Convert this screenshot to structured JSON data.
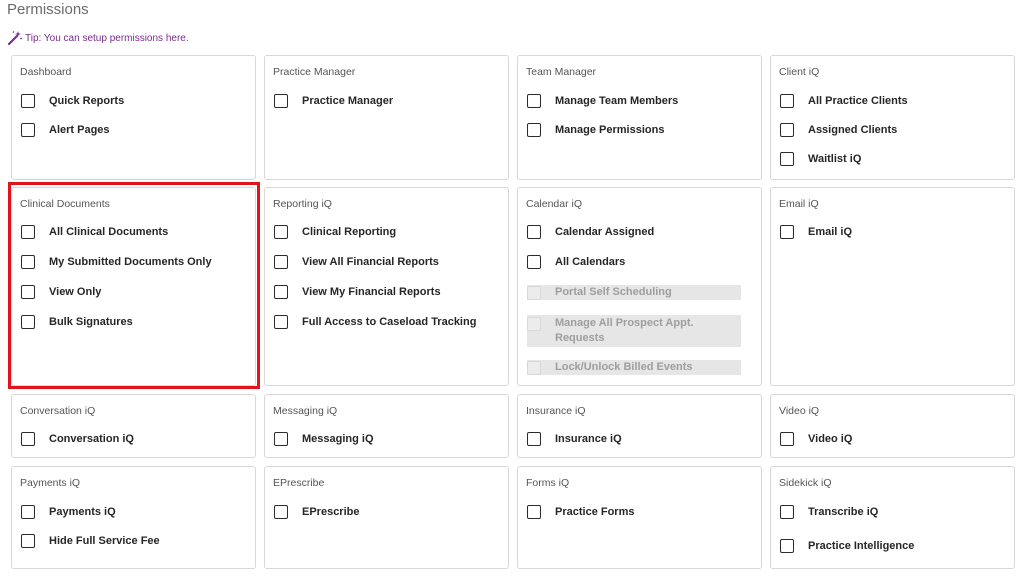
{
  "page": {
    "title": "Permissions",
    "tip": "Tip: You can setup permissions here."
  },
  "colors": {
    "highlight": "#e0141b",
    "tip": "#7a2b8c"
  },
  "cards": {
    "dashboard": {
      "title": "Dashboard",
      "items": [
        "Quick Reports",
        "Alert Pages"
      ]
    },
    "practice_manager": {
      "title": "Practice Manager",
      "items": [
        "Practice Manager"
      ]
    },
    "team_manager": {
      "title": "Team Manager",
      "items": [
        "Manage Team Members",
        "Manage Permissions"
      ]
    },
    "client_iq": {
      "title": "Client iQ",
      "items": [
        "All Practice Clients",
        "Assigned Clients",
        "Waitlist iQ"
      ]
    },
    "clinical_documents": {
      "title": "Clinical Documents",
      "items": [
        "All Clinical Documents",
        "My Submitted Documents Only",
        "View Only",
        "Bulk Signatures"
      ]
    },
    "reporting_iq": {
      "title": "Reporting iQ",
      "items": [
        "Clinical Reporting",
        "View All Financial Reports",
        "View My Financial Reports",
        "Full Access to Caseload Tracking"
      ]
    },
    "calendar_iq": {
      "title": "Calendar iQ",
      "items": [
        "Calendar Assigned",
        "All Calendars"
      ],
      "disabled_items": [
        "Portal Self Scheduling",
        "Manage All Prospect Appt. Requests",
        "Lock/Unlock Billed Events"
      ]
    },
    "email_iq": {
      "title": "Email iQ",
      "items": [
        "Email iQ"
      ]
    },
    "conversation_iq": {
      "title": "Conversation iQ",
      "items": [
        "Conversation iQ"
      ]
    },
    "messaging_iq": {
      "title": "Messaging iQ",
      "items": [
        "Messaging iQ"
      ]
    },
    "insurance_iq": {
      "title": "Insurance iQ",
      "items": [
        "Insurance iQ"
      ]
    },
    "video_iq": {
      "title": "Video iQ",
      "items": [
        "Video iQ"
      ]
    },
    "payments_iq": {
      "title": "Payments iQ",
      "items": [
        "Payments iQ",
        "Hide Full Service Fee"
      ]
    },
    "eprescribe": {
      "title": "EPrescribe",
      "items": [
        "EPrescribe"
      ]
    },
    "forms_iq": {
      "title": "Forms iQ",
      "items": [
        "Practice Forms"
      ]
    },
    "sidekick_iq": {
      "title": "Sidekick iQ",
      "items": [
        "Transcribe iQ",
        "Practice Intelligence"
      ]
    }
  }
}
